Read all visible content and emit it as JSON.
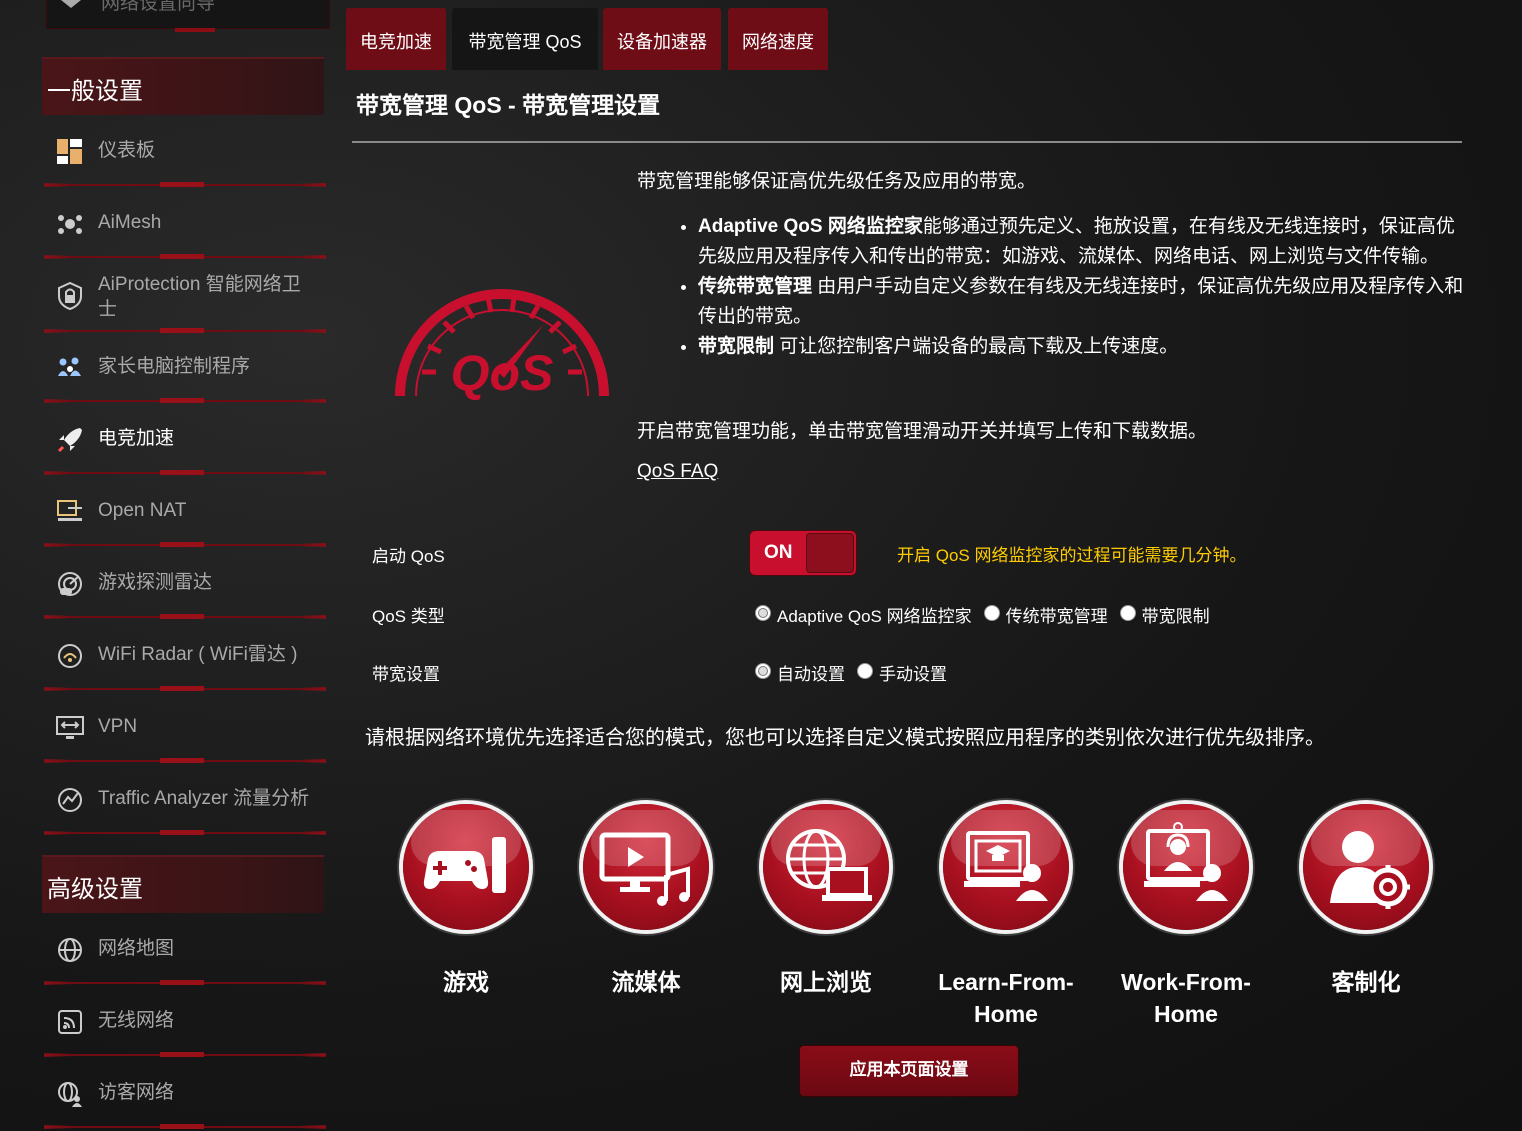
{
  "sidebar": {
    "top_cut_label": "网络设置向导",
    "general_header": "一般设置",
    "general_items": [
      {
        "label": "仪表板",
        "icon": "dashboard-icon"
      },
      {
        "label": "AiMesh",
        "icon": "aimesh-icon"
      },
      {
        "label": "AiProtection 智能网络卫士",
        "icon": "shield-lock-icon"
      },
      {
        "label": "家长电脑控制程序",
        "icon": "family-icon"
      },
      {
        "label": "电竞加速",
        "icon": "rocket-icon"
      },
      {
        "label": "Open NAT",
        "icon": "open-nat-icon"
      },
      {
        "label": "游戏探测雷达",
        "icon": "game-radar-icon"
      },
      {
        "label": "WiFi Radar ( WiFi雷达 )",
        "icon": "wifi-radar-icon"
      },
      {
        "label": "VPN",
        "icon": "vpn-icon"
      },
      {
        "label": "Traffic Analyzer 流量分析",
        "icon": "traffic-analyzer-icon"
      }
    ],
    "advanced_header": "高级设置",
    "advanced_items": [
      {
        "label": "网络地图",
        "icon": "globe-icon"
      },
      {
        "label": "无线网络",
        "icon": "wireless-icon"
      },
      {
        "label": "访客网络",
        "icon": "guest-network-icon"
      }
    ]
  },
  "tabs": [
    {
      "label": "电竞加速"
    },
    {
      "label": "带宽管理 QoS"
    },
    {
      "label": "设备加速器"
    },
    {
      "label": "网络速度"
    }
  ],
  "main": {
    "title": "带宽管理 QoS - 带宽管理设置",
    "intro": "带宽管理能够保证高优先级任务及应用的带宽。",
    "bullets": [
      {
        "bold": "Adaptive QoS 网络监控家",
        "text": "能够通过预先定义、拖放设置，在有线及无线连接时，保证高优先级应用及程序传入和传出的带宽：如游戏、流媒体、网络电话、网上浏览与文件传输。"
      },
      {
        "bold": "传统带宽管理",
        "text": " 由用户手动自定义参数在有线及无线连接时，保证高优先级应用及程序传入和传出的带宽。"
      },
      {
        "bold": "带宽限制",
        "text": " 可让您控制客户端设备的最高下载及上传速度。"
      }
    ],
    "instruction": "开启带宽管理功能，单击带宽管理滑动开关并填写上传和下载数据。",
    "faq_link": "QoS FAQ",
    "enable_label": "启动 QoS",
    "toggle_text": "ON",
    "enable_note": "开启 QoS 网络监控家的过程可能需要几分钟。",
    "qos_type_label": "QoS 类型",
    "qos_type_options": [
      "Adaptive QoS 网络监控家",
      "传统带宽管理",
      "带宽限制"
    ],
    "bandwidth_label": "带宽设置",
    "bandwidth_options": [
      "自动设置",
      "手动设置"
    ],
    "mode_intro": "请根据网络环境优先选择适合您的模式，您也可以选择自定义模式按照应用程序的类别依次进行优先级排序。",
    "modes": [
      {
        "line1": "游戏",
        "line2": "",
        "icon": "gamepad-icon"
      },
      {
        "line1": "流媒体",
        "line2": "",
        "icon": "media-streaming-icon"
      },
      {
        "line1": "网上浏览",
        "line2": "",
        "icon": "web-browsing-icon"
      },
      {
        "line1": "Learn-From-",
        "line2": "Home",
        "icon": "learn-from-home-icon"
      },
      {
        "line1": "Work-From-",
        "line2": "Home",
        "icon": "work-from-home-icon"
      },
      {
        "line1": "客制化",
        "line2": "",
        "icon": "customize-icon"
      }
    ],
    "apply_button": "应用本页面设置",
    "logo_text": "QoS"
  },
  "colors": {
    "accent": "#c8102e",
    "tab_bg": "#6f0d16",
    "note": "#ffcc00"
  }
}
